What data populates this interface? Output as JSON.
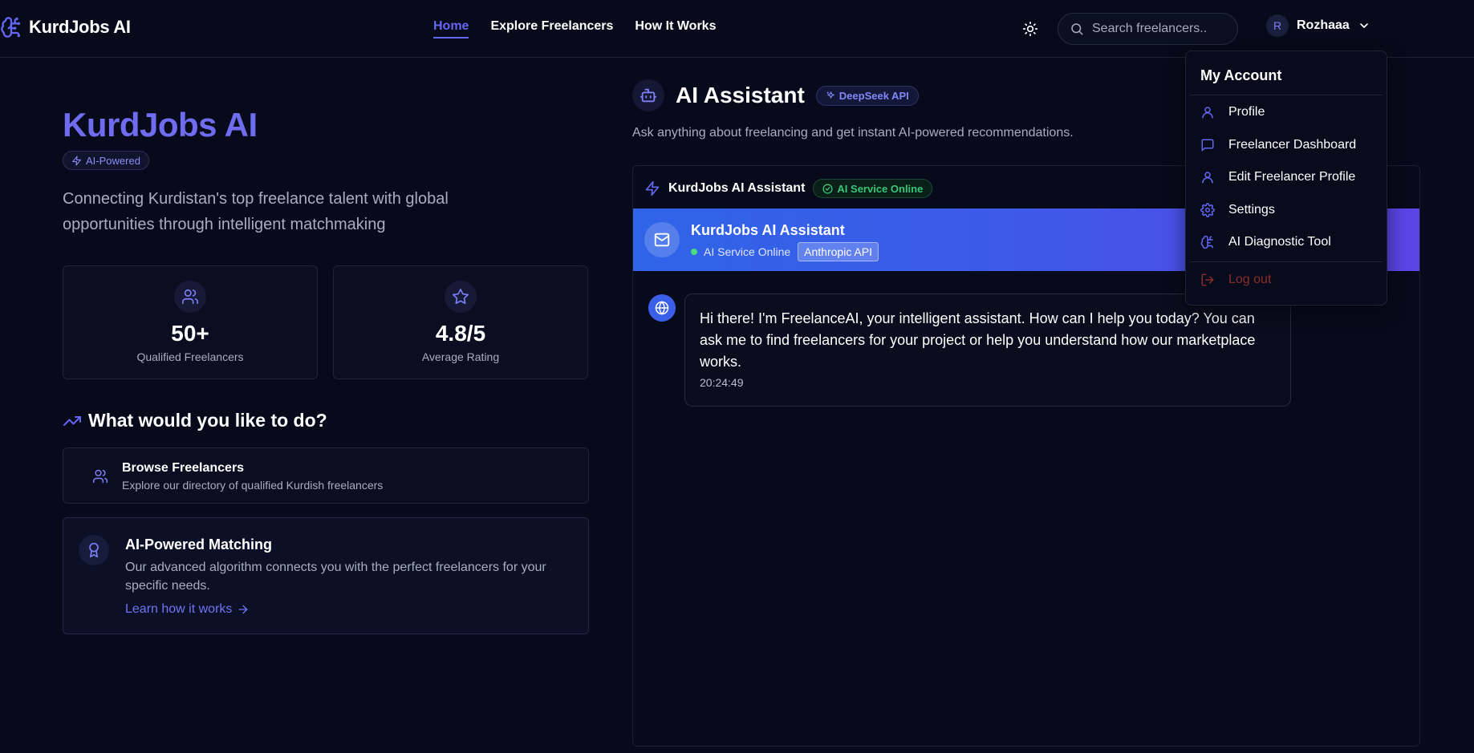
{
  "header": {
    "brand": "KurdJobs AI",
    "nav": [
      "Home",
      "Explore Freelancers",
      "How It Works"
    ],
    "search_placeholder": "Search freelancers..",
    "user_initial": "R",
    "user_name": "Rozhaaa"
  },
  "hero": {
    "title": "KurdJobs AI",
    "badge": "AI-Powered",
    "description": "Connecting Kurdistan's top freelance talent with global opportunities through intelligent matchmaking"
  },
  "stats": [
    {
      "value": "50+",
      "label": "Qualified Freelancers",
      "icon": "users-icon"
    },
    {
      "value": "4.8/5",
      "label": "Average Rating",
      "icon": "star-icon"
    }
  ],
  "actions": {
    "heading": "What would you like to do?",
    "browse": {
      "title": "Browse Freelancers",
      "subtitle": "Explore our directory of qualified Kurdish freelancers"
    },
    "matching": {
      "title": "AI-Powered Matching",
      "description": "Our advanced algorithm connects you with the perfect freelancers for your specific needs.",
      "link": "Learn how it works"
    }
  },
  "assistant": {
    "title": "AI Assistant",
    "api_badge": "DeepSeek API",
    "subtitle": "Ask anything about freelancing and get instant AI-powered recommendations.",
    "panel_title": "KurdJobs AI Assistant",
    "panel_status": "AI Service Online",
    "bar_name": "KurdJobs AI Assistant",
    "bar_status": "AI Service Online",
    "bar_api": "Anthropic API",
    "message": "Hi there! I'm FreelanceAI, your intelligent assistant. How can I help you today? You can ask me to find freelancers for your project or help you understand how our marketplace works.",
    "message_time": "20:24:49"
  },
  "account_menu": {
    "title": "My Account",
    "items": [
      {
        "label": "Profile",
        "icon": "user-icon"
      },
      {
        "label": "Freelancer Dashboard",
        "icon": "message-square-icon"
      },
      {
        "label": "Edit Freelancer Profile",
        "icon": "user-icon"
      },
      {
        "label": "Settings",
        "icon": "gear-icon"
      },
      {
        "label": "AI Diagnostic Tool",
        "icon": "brain-icon"
      }
    ],
    "logout": "Log out"
  },
  "colors": {
    "background": "#070a1a",
    "accent": "#6366f1",
    "online": "#35c777",
    "logout": "#8a2c2c"
  }
}
